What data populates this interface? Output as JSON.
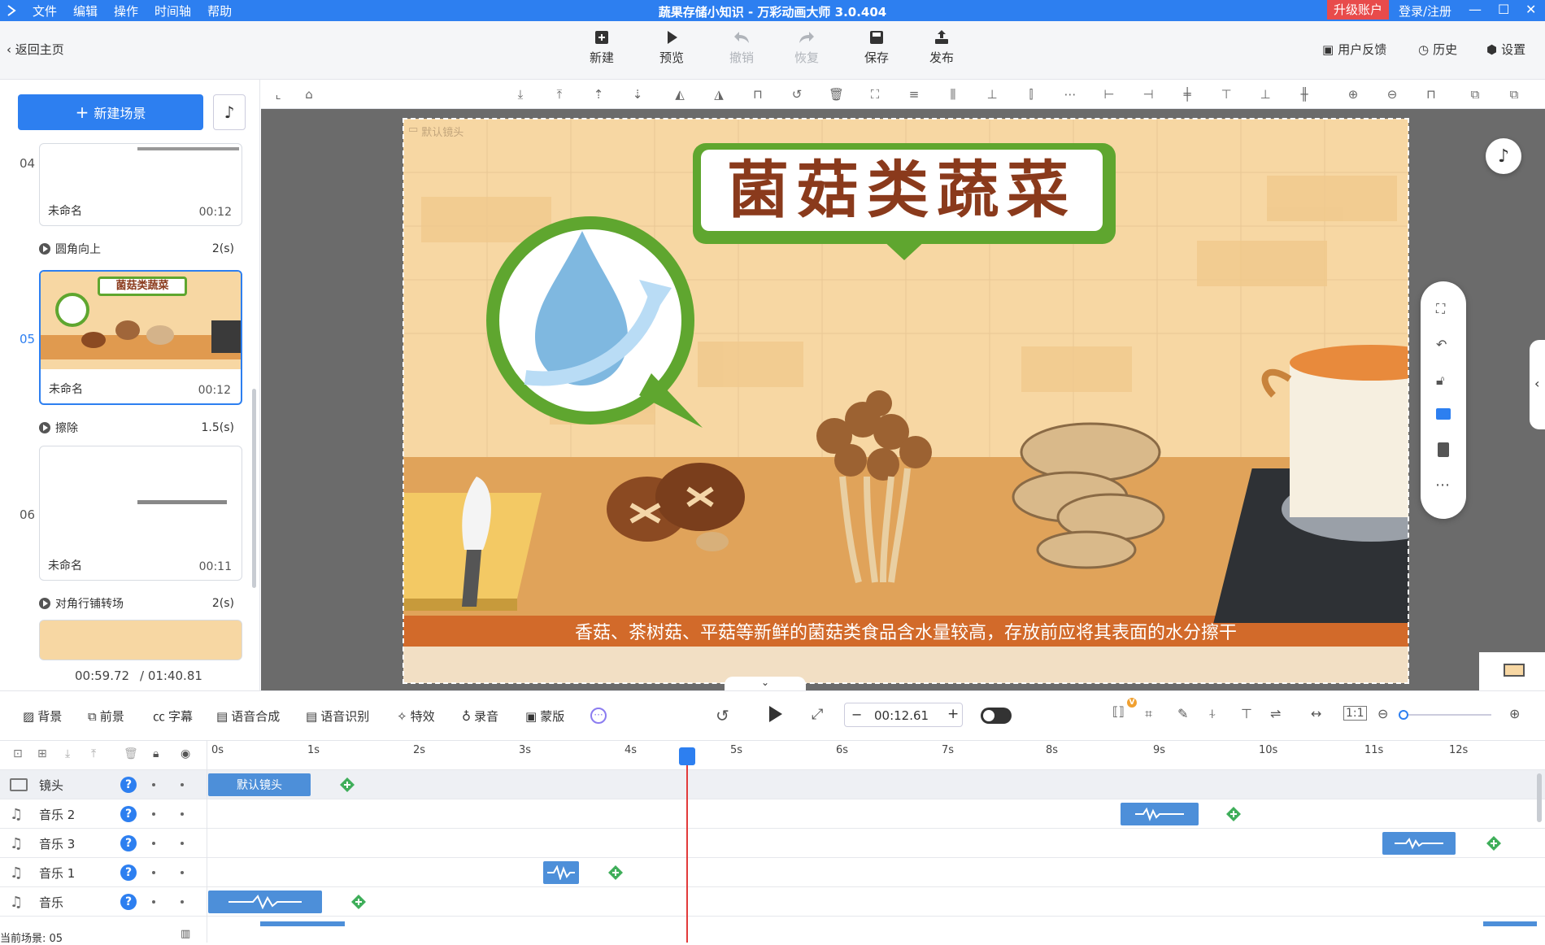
{
  "titlebar": {
    "menu": [
      "文件",
      "编辑",
      "操作",
      "时间轴",
      "帮助"
    ],
    "title": "蔬果存储小知识 - 万彩动画大师 3.0.404",
    "upgrade": "升级账户",
    "login": "登录/注册"
  },
  "toolbar": {
    "back": "返回主页",
    "buttons": [
      {
        "label": "新建",
        "icon": "plus-square-icon",
        "enabled": true
      },
      {
        "label": "预览",
        "icon": "play-icon",
        "enabled": true
      },
      {
        "label": "撤销",
        "icon": "undo-icon",
        "enabled": false
      },
      {
        "label": "恢复",
        "icon": "redo-icon",
        "enabled": false
      },
      {
        "label": "保存",
        "icon": "save-icon",
        "enabled": true
      },
      {
        "label": "发布",
        "icon": "publish-icon",
        "enabled": true
      }
    ],
    "right": [
      "用户反馈",
      "历史",
      "设置"
    ]
  },
  "left_panel": {
    "new_scene": "新建场景",
    "scenes": [
      {
        "num": "04",
        "name": "未命名",
        "time": "00:12"
      },
      {
        "num": "05",
        "name": "未命名",
        "time": "00:12"
      },
      {
        "num": "06",
        "name": "未命名",
        "time": "00:11"
      }
    ],
    "transitions": [
      {
        "name": "圆角向上",
        "dur": "2(s)"
      },
      {
        "name": "擦除",
        "dur": "1.5(s)"
      },
      {
        "name": "对角行铺转场",
        "dur": "2(s)"
      }
    ],
    "time_current": "00:59.72",
    "time_total": "/ 01:40.81"
  },
  "canvas": {
    "camera_label": "默认镜头",
    "title_text": "菌菇类蔬菜",
    "thumb_title": "菌菇类蔬菜",
    "subtitle": "香菇、茶树菇、平菇等新鲜的菌菇类食品含水量较高，存放前应将其表面的水分擦干",
    "bg_color": "#f7d7a3",
    "accent_green": "#5fa62f"
  },
  "bottom_toolbar": {
    "items": [
      "背景",
      "前景",
      "字幕",
      "语音合成",
      "语音识别",
      "特效",
      "录音",
      "蒙版"
    ],
    "time": "00:12.61"
  },
  "timeline": {
    "ticks": [
      "0s",
      "1s",
      "2s",
      "3s",
      "4s",
      "5s",
      "6s",
      "7s",
      "8s",
      "9s",
      "10s",
      "11s",
      "12s"
    ],
    "playhead_seconds": 4.5,
    "tracks": [
      {
        "name": "镜头",
        "clip_label": "默认镜头"
      },
      {
        "name": "音乐 2"
      },
      {
        "name": "音乐 3"
      },
      {
        "name": "音乐 1"
      },
      {
        "name": "音乐"
      }
    ],
    "current_scene": "当前场景: 05"
  }
}
